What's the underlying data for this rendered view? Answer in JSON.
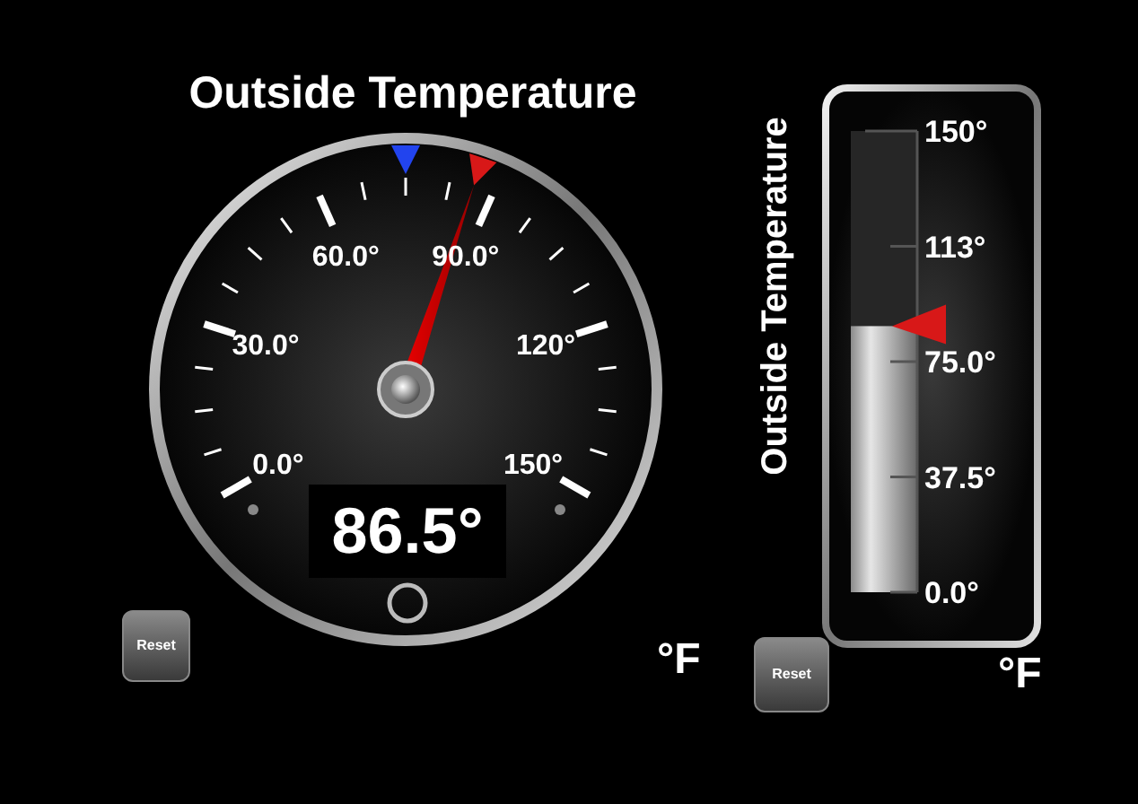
{
  "dial": {
    "title": "Outside Temperature",
    "scale_labels": [
      "0.0°",
      "30.0°",
      "60.0°",
      "90.0°",
      "120°",
      "150°"
    ],
    "level": 0.577,
    "readout": "86.5°",
    "unit": "°F",
    "reset_button": "Reset"
  },
  "bar_gauge": {
    "title": "Outside Temperature",
    "scale_labels": [
      "150°",
      "113°",
      "75.0°",
      "37.5°",
      "0.0°"
    ],
    "level": 0.577,
    "unit": "°F",
    "reset_button": "Reset"
  }
}
